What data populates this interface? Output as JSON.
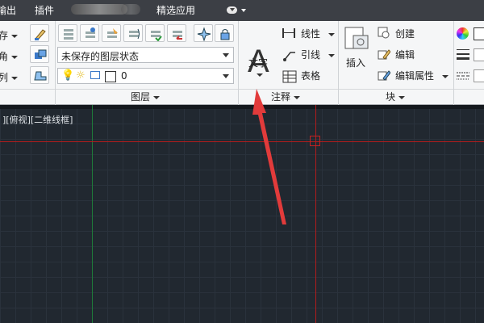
{
  "menubar": {
    "items": [
      "输出",
      "插件",
      "精选应用"
    ]
  },
  "ribbon": {
    "left_partial": [
      "存",
      "角",
      "列"
    ],
    "layer": {
      "state_value": "未保存的图层状态",
      "current_layer": "0",
      "panel_title": "图层"
    },
    "annotation": {
      "text_label": "文字",
      "dimension_label": "线性",
      "leader_label": "引线",
      "table_label": "表格",
      "panel_title": "注释"
    },
    "block": {
      "insert_label": "插入",
      "create_label": "创建",
      "edit_label": "编辑",
      "edit_attr_label": "编辑属性",
      "panel_title": "块"
    }
  },
  "viewport": {
    "label": "][俯视][二维线框]"
  },
  "colors": {
    "menubar": "#3c3f45",
    "canvas": "#212830",
    "x_axis": "#b21c1c",
    "y_axis": "#1f7a3a",
    "annotation_arrow": "#e23b3b"
  }
}
